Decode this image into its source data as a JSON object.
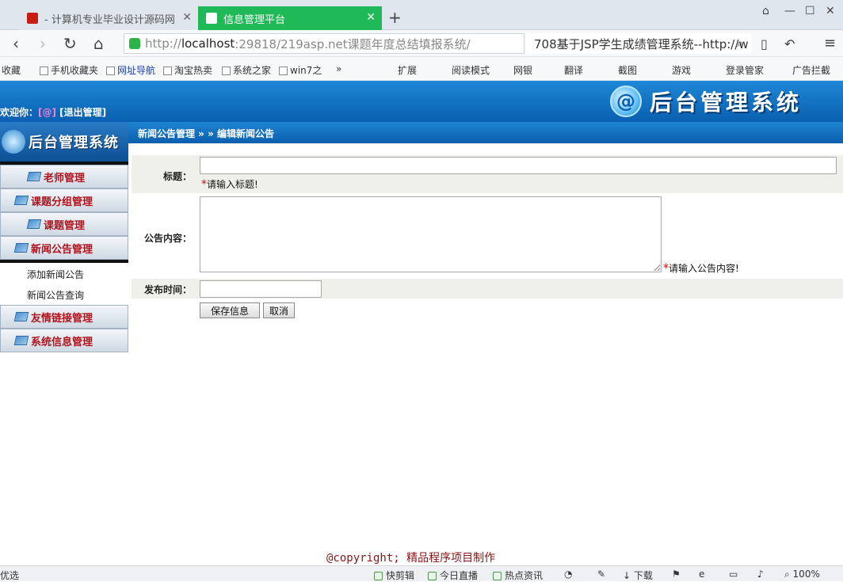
{
  "browser": {
    "tabs": [
      {
        "label": "- 计算机专业毕业设计源码网",
        "active": false
      },
      {
        "label": "信息管理平台",
        "active": true
      }
    ],
    "address": {
      "prefix": "http://",
      "host": "localhost",
      "rest": ":29818/219asp.net课题年度总结填报系统/"
    },
    "search_text": "708基于JSP学生成绩管理系统--http://w",
    "bookmarks": [
      "收藏",
      "手机收藏夹",
      "网址导航",
      "淘宝热卖",
      "系统之家",
      "win7之"
    ],
    "bookmarks_right": [
      "扩展",
      "阅读模式",
      "网银",
      "翻译",
      "截图",
      "游戏",
      "登录管家",
      "广告拦截"
    ]
  },
  "header": {
    "welcome": "欢迎你：",
    "user": "[@]",
    "logout": "[退出管理]",
    "logo_text": "后台管理系统",
    "logo_symbol": "@"
  },
  "sidebar": {
    "brand": "后台管理系统",
    "items": [
      {
        "label": "老师管理"
      },
      {
        "label": "课题分组管理"
      },
      {
        "label": "课题管理"
      },
      {
        "label": "新闻公告管理"
      },
      {
        "label": "友情链接管理"
      },
      {
        "label": "系统信息管理"
      }
    ],
    "subitems": [
      "添加新闻公告",
      "新闻公告查询"
    ]
  },
  "breadcrumb": "新闻公告管理 » » 编辑新闻公告",
  "form": {
    "title_label": "标题：",
    "title_value": "",
    "title_hint": "请输入标题!",
    "content_label": "公告内容：",
    "content_value": "",
    "content_hint": "请输入公告内容!",
    "time_label": "发布时间：",
    "time_value": "",
    "save_button": "保存信息",
    "cancel_button": "取消",
    "required_mark": "*"
  },
  "footer": {
    "copyright": "@copyright; 精品程序项目制作"
  },
  "statusbar": {
    "left": "优选",
    "items": [
      "快剪辑",
      "今日直播",
      "热点资讯",
      "下载"
    ],
    "zoom": "100%"
  }
}
